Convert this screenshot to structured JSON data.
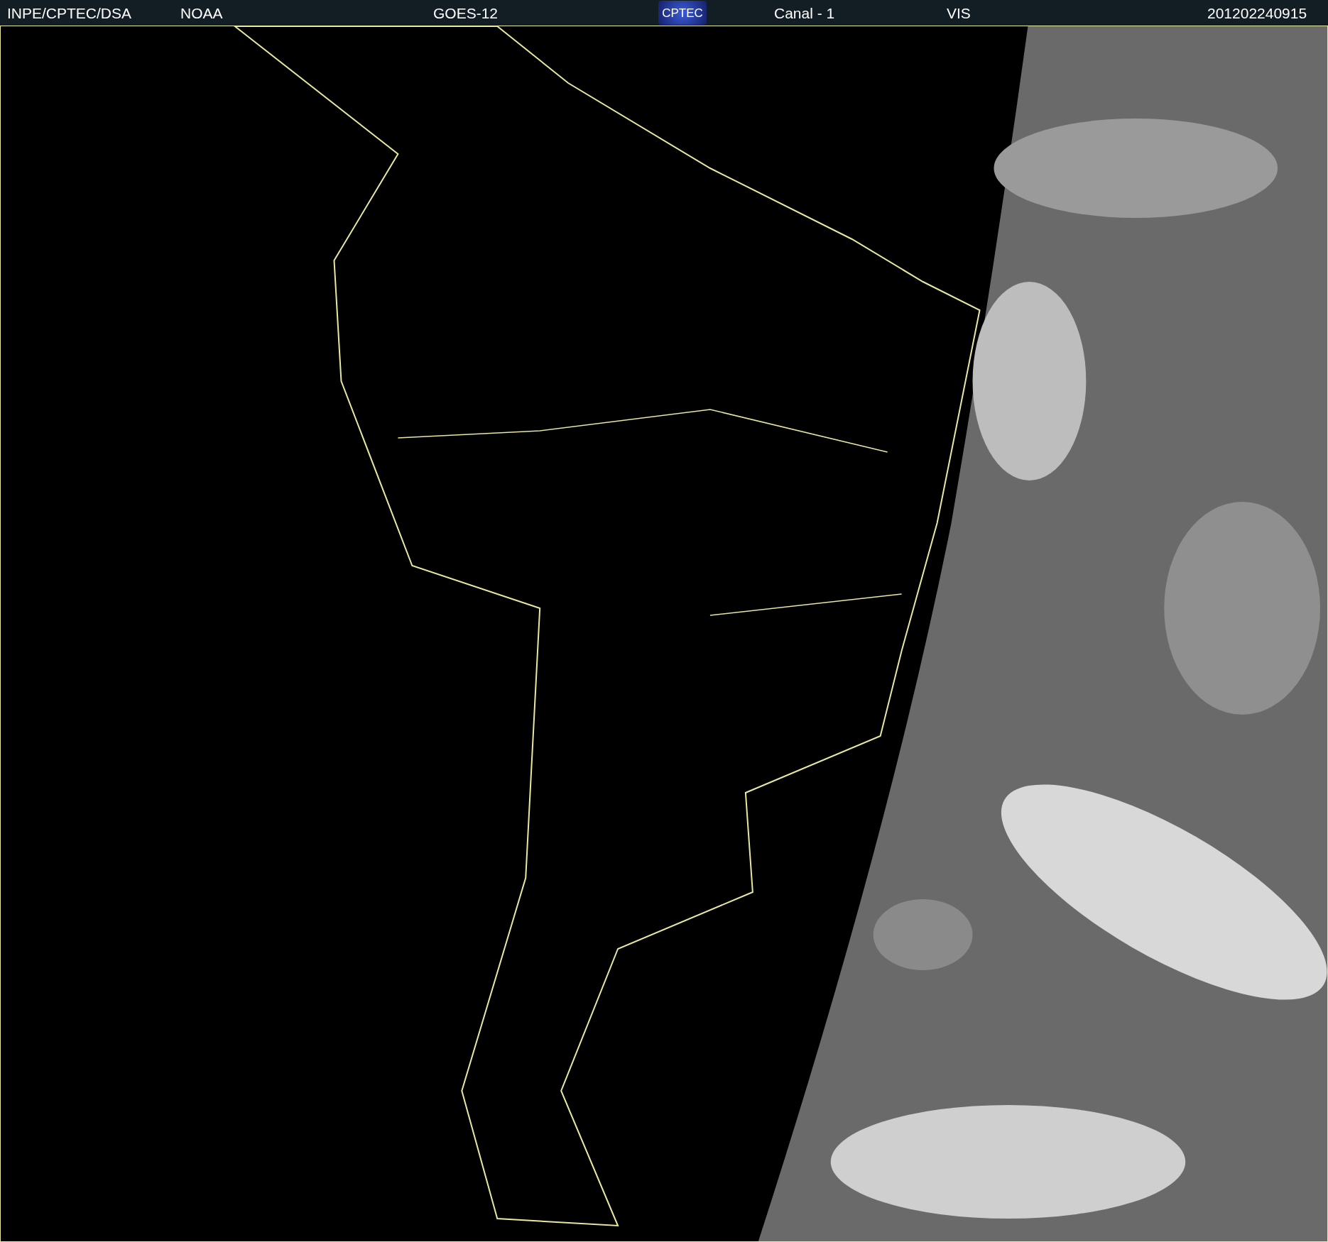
{
  "header": {
    "items": [
      {
        "kind": "text",
        "text": "INPE/CPTEC/DSA"
      },
      {
        "kind": "text",
        "text": "NOAA"
      },
      {
        "kind": "text",
        "text": "GOES-12"
      },
      {
        "kind": "logo",
        "text": "CPTEC"
      },
      {
        "kind": "text",
        "text": "Canal - 1"
      },
      {
        "kind": "text",
        "text": "VIS"
      },
      {
        "kind": "text",
        "text": "201202240915"
      }
    ]
  }
}
